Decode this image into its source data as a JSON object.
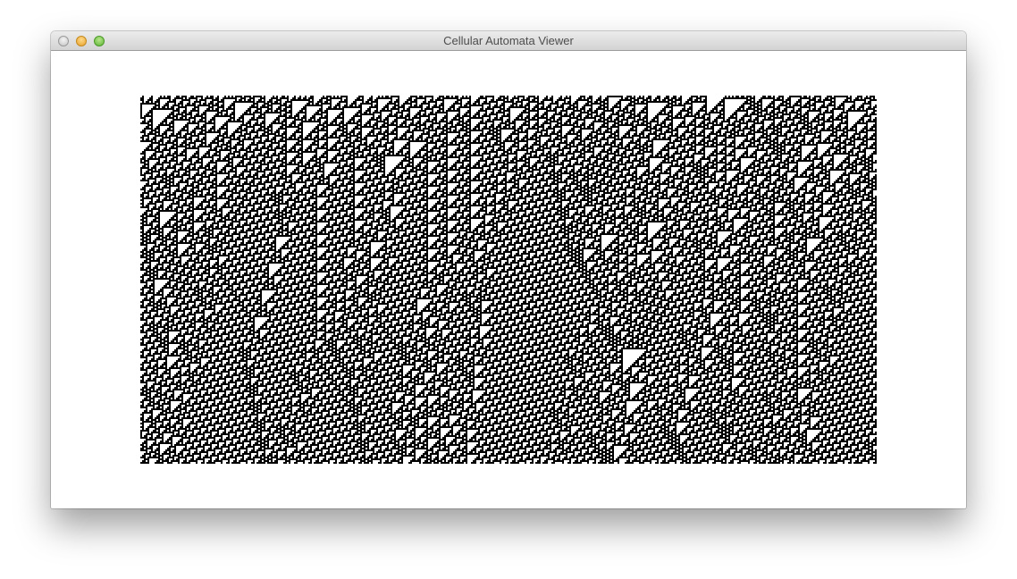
{
  "window": {
    "title": "Cellular Automata Viewer"
  },
  "automaton": {
    "cell_on_color": "#000000",
    "cell_off_color": "#ffffff"
  }
}
